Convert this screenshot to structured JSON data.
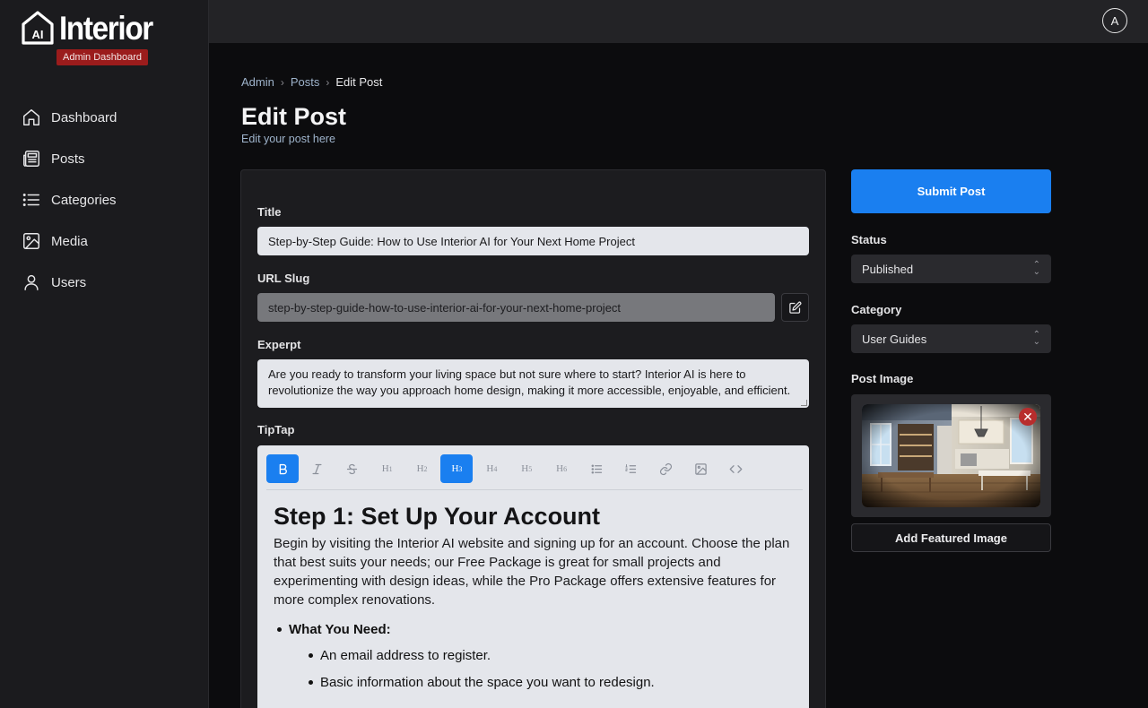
{
  "brand": {
    "logo_mark": "AI",
    "name": "Interior",
    "badge": "Admin Dashboard"
  },
  "sidebar": {
    "items": [
      {
        "label": "Dashboard",
        "icon": "home-icon"
      },
      {
        "label": "Posts",
        "icon": "newspaper-icon"
      },
      {
        "label": "Categories",
        "icon": "list-icon"
      },
      {
        "label": "Media",
        "icon": "image-icon"
      },
      {
        "label": "Users",
        "icon": "user-icon"
      }
    ]
  },
  "topbar": {
    "avatar_initial": "A"
  },
  "breadcrumb": [
    "Admin",
    "Posts",
    "Edit Post"
  ],
  "page": {
    "title": "Edit Post",
    "subtitle": "Edit your post here"
  },
  "form": {
    "title_label": "Title",
    "title_value": "Step-by-Step Guide: How to Use Interior AI for Your Next Home Project",
    "slug_label": "URL Slug",
    "slug_value": "step-by-step-guide-how-to-use-interior-ai-for-your-next-home-project",
    "excerpt_label": "Experpt",
    "excerpt_value": "Are you ready to transform your living space but not sure where to start? Interior AI is here to revolutionize the way you approach home design, making it more accessible, enjoyable, and efficient.",
    "editor_label": "TipTap"
  },
  "editor": {
    "toolbar": [
      {
        "name": "bold",
        "label": "B",
        "active": true
      },
      {
        "name": "italic",
        "label": "I",
        "active": false
      },
      {
        "name": "strike",
        "label": "S",
        "active": false
      },
      {
        "name": "h1",
        "label": "H1",
        "active": false
      },
      {
        "name": "h2",
        "label": "H2",
        "active": false
      },
      {
        "name": "h3",
        "label": "H3",
        "active": true
      },
      {
        "name": "h4",
        "label": "H4",
        "active": false
      },
      {
        "name": "h5",
        "label": "H5",
        "active": false
      },
      {
        "name": "h6",
        "label": "H6",
        "active": false
      },
      {
        "name": "bullet-list",
        "label": "",
        "active": false
      },
      {
        "name": "ordered-list",
        "label": "",
        "active": false
      },
      {
        "name": "link",
        "label": "",
        "active": false
      },
      {
        "name": "image",
        "label": "",
        "active": false
      },
      {
        "name": "code",
        "label": "",
        "active": false
      }
    ],
    "heading": "Step 1: Set Up Your Account",
    "paragraph": "Begin by visiting the Interior AI website and signing up for an account. Choose the plan that best suits your needs; our Free Package is great for small projects and experimenting with design ideas, while the Pro Package offers extensive features for more complex renovations.",
    "list_heading": "What You Need:",
    "list_items": [
      "An email address to register.",
      "Basic information about the space you want to redesign."
    ]
  },
  "right_panel": {
    "submit_label": "Submit Post",
    "status_label": "Status",
    "status_value": "Published",
    "category_label": "Category",
    "category_value": "User Guides",
    "image_label": "Post Image",
    "add_image_label": "Add Featured Image"
  },
  "colors": {
    "accent": "#1a7ff0",
    "danger": "#b82d2d",
    "badge": "#9b1c1c"
  }
}
